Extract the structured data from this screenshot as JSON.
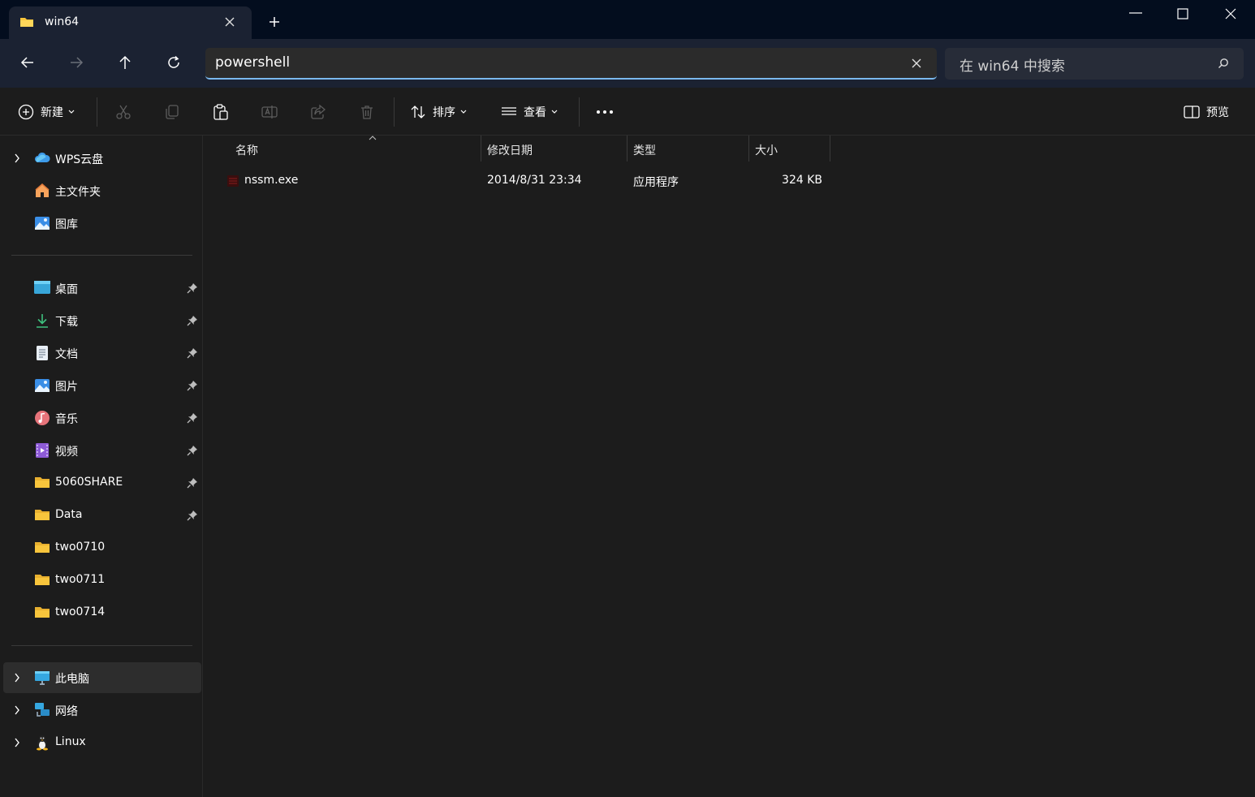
{
  "window": {
    "tab_title": "win64",
    "minimize_icon": "minimize-icon",
    "maximize_icon": "maximize-icon",
    "close_icon": "close-icon"
  },
  "navbar": {
    "address_value": "powershell",
    "search_placeholder": "在 win64 中搜索"
  },
  "commandbar": {
    "new_label": "新建",
    "sort_label": "排序",
    "view_label": "查看",
    "preview_label": "预览"
  },
  "sidebar": {
    "top": [
      {
        "label": "WPS云盘",
        "icon": "cloud-icon"
      },
      {
        "label": "主文件夹",
        "icon": "home-icon"
      },
      {
        "label": "图库",
        "icon": "gallery-icon"
      }
    ],
    "pinned": [
      {
        "label": "桌面",
        "icon": "desktop-icon"
      },
      {
        "label": "下载",
        "icon": "download-icon"
      },
      {
        "label": "文档",
        "icon": "document-icon"
      },
      {
        "label": "图片",
        "icon": "pictures-icon"
      },
      {
        "label": "音乐",
        "icon": "music-icon"
      },
      {
        "label": "视频",
        "icon": "video-icon"
      },
      {
        "label": "5060SHARE",
        "icon": "folder-icon"
      },
      {
        "label": "Data",
        "icon": "folder-icon"
      }
    ],
    "folders": [
      {
        "label": "two0710",
        "icon": "folder-icon"
      },
      {
        "label": "two0711",
        "icon": "folder-icon"
      },
      {
        "label": "two0714",
        "icon": "folder-icon"
      }
    ],
    "bottom": [
      {
        "label": "此电脑",
        "icon": "pc-icon"
      },
      {
        "label": "网络",
        "icon": "network-icon"
      },
      {
        "label": "Linux",
        "icon": "linux-icon"
      }
    ]
  },
  "filelist": {
    "columns": [
      "名称",
      "修改日期",
      "类型",
      "大小"
    ],
    "rows": [
      {
        "name": "nssm.exe",
        "modified": "2014/8/31 23:34",
        "type": "应用程序",
        "size": "324 KB"
      }
    ]
  },
  "colors": {
    "titlebar_bg": "#030d1e",
    "navbar_bg": "#1b2232",
    "body_bg": "#1c1c1c",
    "accent": "#7ab8ee",
    "folder_yellow": "#f8c53c"
  }
}
